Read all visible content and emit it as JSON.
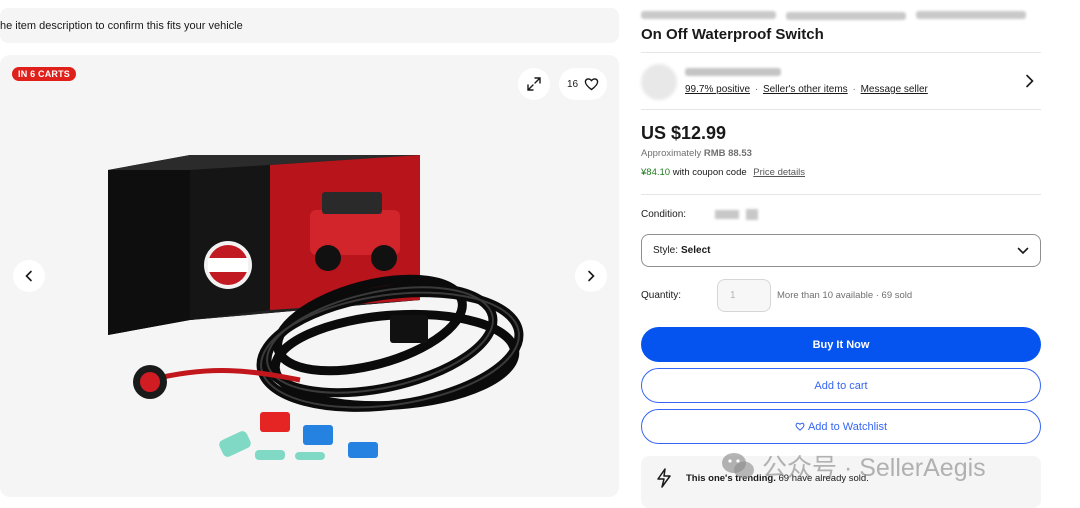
{
  "notice": {
    "text": "he item description to confirm this fits your vehicle"
  },
  "gallery": {
    "cart_badge": "IN 6 CARTS",
    "watch_count": "16",
    "icons": {
      "expand": "expand-icon",
      "heart": "heart-icon",
      "prev": "chevron-left-icon",
      "next": "chevron-right-icon"
    }
  },
  "listing": {
    "title_visible": "On Off Waterproof Switch"
  },
  "seller": {
    "positive": "99.7% positive",
    "other_items": "Seller's other items",
    "message": "Message seller",
    "sep": "·"
  },
  "pricing": {
    "price": "US $12.99",
    "approx_prefix": "Approximately",
    "approx_value": "RMB 88.53",
    "coupon_price": "¥84.10",
    "coupon_text": "with coupon code",
    "price_details": "Price details"
  },
  "condition": {
    "label": "Condition:"
  },
  "style": {
    "label": "Style:",
    "value": "Select"
  },
  "quantity": {
    "label": "Quantity:",
    "value": "1",
    "availability": "More than 10 available · 69 sold"
  },
  "actions": {
    "buy_now": "Buy It Now",
    "add_to_cart": "Add to cart",
    "add_to_watchlist": "Add to Watchlist"
  },
  "trending": {
    "bold": "This one's trending.",
    "rest": "69 have already sold."
  },
  "watermark": {
    "text": "公众号 · SellerAegis"
  },
  "colors": {
    "primary": "#0654f0",
    "badge": "#e0201b",
    "link": "#3665f3",
    "coupon_green": "#1e7b1e"
  }
}
